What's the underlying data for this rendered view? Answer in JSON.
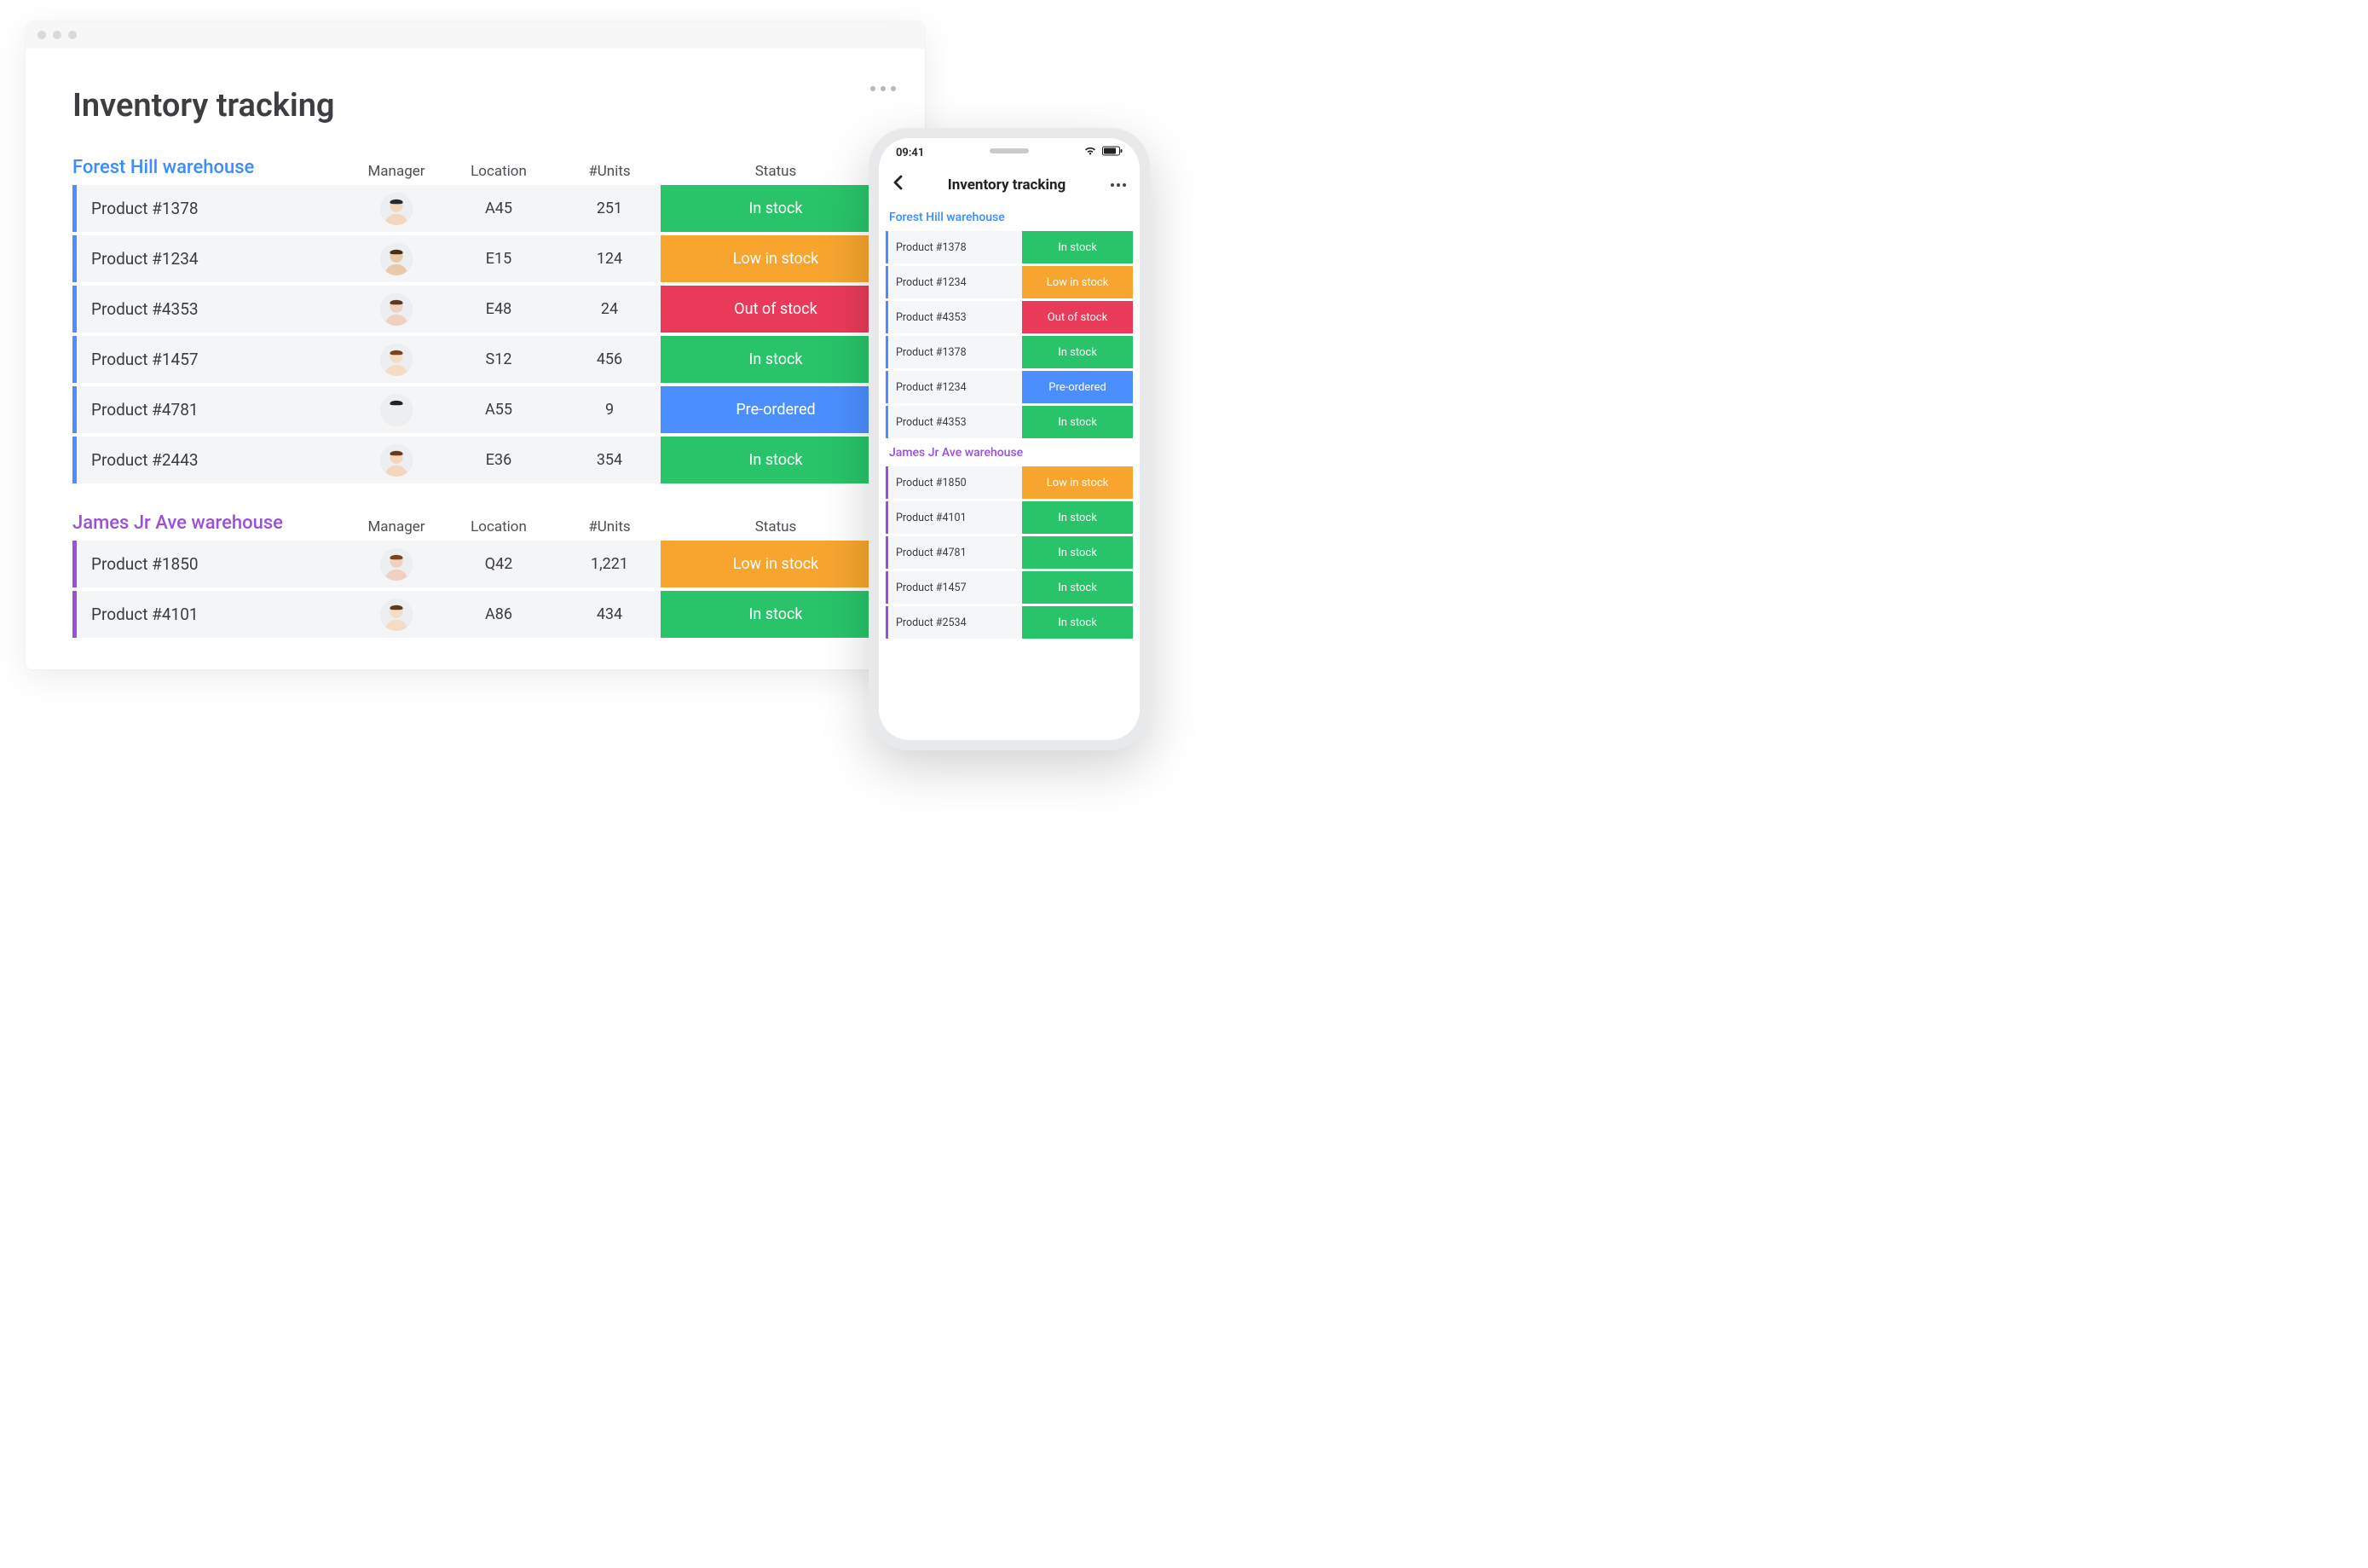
{
  "page_title": "Inventory tracking",
  "columns": {
    "manager": "Manager",
    "location": "Location",
    "units": "#Units",
    "status": "Status"
  },
  "status_labels": {
    "in_stock": "In stock",
    "low": "Low in stock",
    "out": "Out of stock",
    "pre": "Pre-ordered"
  },
  "colors": {
    "in_stock": "#29c46a",
    "low": "#f7a52e",
    "out": "#ea3a59",
    "pre": "#4b8fff",
    "accent_blue": "#4b8fff",
    "accent_purple": "#9b4fdd"
  },
  "desktop": {
    "sections": [
      {
        "title": "Forest Hill warehouse",
        "accent": "blue",
        "rows": [
          {
            "product": "Product  #1378",
            "location": "A45",
            "units": "251",
            "status": "in_stock"
          },
          {
            "product": "Product  #1234",
            "location": "E15",
            "units": "124",
            "status": "low"
          },
          {
            "product": "Product  #4353",
            "location": "E48",
            "units": "24",
            "status": "out"
          },
          {
            "product": "Product  #1457",
            "location": "S12",
            "units": "456",
            "status": "in_stock"
          },
          {
            "product": "Product  #4781",
            "location": "A55",
            "units": "9",
            "status": "pre"
          },
          {
            "product": "Product  #2443",
            "location": "E36",
            "units": "354",
            "status": "in_stock"
          }
        ]
      },
      {
        "title": "James Jr Ave warehouse",
        "accent": "purple",
        "rows": [
          {
            "product": "Product  #1850",
            "location": "Q42",
            "units": "1,221",
            "status": "low"
          },
          {
            "product": "Product  #4101",
            "location": "A86",
            "units": "434",
            "status": "in_stock"
          }
        ]
      }
    ]
  },
  "phone": {
    "time": "09:41",
    "title": "Inventory tracking",
    "sections": [
      {
        "title": "Forest Hill warehouse",
        "accent": "blue",
        "rows": [
          {
            "product": "Product #1378",
            "status": "in_stock"
          },
          {
            "product": "Product  #1234",
            "status": "low"
          },
          {
            "product": "Product  #4353",
            "status": "out"
          },
          {
            "product": "Product  #1378",
            "status": "in_stock"
          },
          {
            "product": "Product  #1234",
            "status": "pre"
          },
          {
            "product": "Product  #4353",
            "status": "in_stock"
          }
        ]
      },
      {
        "title": "James Jr Ave warehouse",
        "accent": "purple",
        "rows": [
          {
            "product": "Product  #1850",
            "status": "low"
          },
          {
            "product": "Product  #4101",
            "status": "in_stock"
          },
          {
            "product": "Product  #4781",
            "status": "in_stock"
          },
          {
            "product": "Product  #1457",
            "status": "in_stock"
          },
          {
            "product": "Product  #2534",
            "status": "in_stock"
          }
        ]
      }
    ]
  }
}
